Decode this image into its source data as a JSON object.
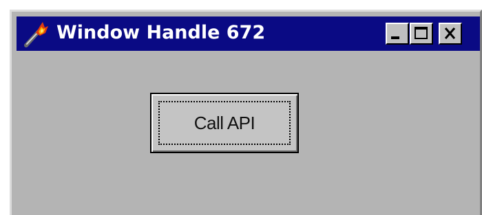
{
  "window": {
    "title": "Window Handle 672",
    "icon": "torch-icon"
  },
  "caption_buttons": {
    "minimize": "minimize-icon",
    "maximize": "maximize-icon",
    "close": "close-icon"
  },
  "main": {
    "call_api_label": "Call API"
  },
  "colors": {
    "titlebar": "#0a0a84",
    "window_body": "#b4b4b4",
    "button_face": "#c4c4c4"
  }
}
